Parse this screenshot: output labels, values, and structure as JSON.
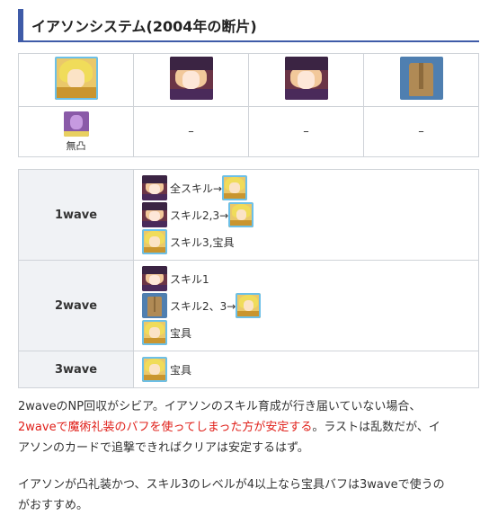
{
  "heading": "イアソンシステム(2004年の断片)",
  "party": {
    "members": [
      {
        "portrait": "jason-portrait-icon"
      },
      {
        "portrait": "witch-caster-portrait-icon"
      },
      {
        "portrait": "witch-caster-portrait-icon"
      },
      {
        "portrait": "mystic-code-coat-icon"
      }
    ],
    "craft_essences": [
      {
        "icon": "craft-essence-icon",
        "label": "無凸"
      },
      {
        "label": "–"
      },
      {
        "label": "–"
      },
      {
        "label": "–"
      }
    ]
  },
  "plan": [
    {
      "wave": "1wave",
      "steps": [
        {
          "actor": "witch-caster-portrait-icon",
          "text": "全スキル→",
          "target": "jason-portrait-icon"
        },
        {
          "actor": "witch-caster-portrait-icon",
          "text": "スキル2,3→",
          "target": "jason-portrait-icon"
        },
        {
          "actor": "jason-portrait-icon",
          "text": "スキル3,宝具"
        }
      ]
    },
    {
      "wave": "2wave",
      "steps": [
        {
          "actor": "witch-caster-portrait-icon",
          "text": "スキル1"
        },
        {
          "actor": "mystic-code-coat-icon",
          "text": "スキル2、3→",
          "target": "jason-portrait-icon"
        },
        {
          "actor": "jason-portrait-icon",
          "text": "宝具"
        }
      ]
    },
    {
      "wave": "3wave",
      "steps": [
        {
          "actor": "jason-portrait-icon",
          "text": "宝具"
        }
      ]
    }
  ],
  "paragraph1": {
    "line1": "2waveのNP回収がシビア。イアソンのスキル育成が行き届いていない場合、",
    "red": "2waveで魔術礼装のバフを使ってしまった方が安定する",
    "after_red": "。ラストは乱数だが、イ",
    "line3": "アソンのカードで追撃できればクリアは安定するはず。"
  },
  "paragraph2": {
    "line1": "イアソンが凸礼装かつ、スキル3のレベルが4以上なら宝具バフは3waveで使うの",
    "line2": "がおすすめ。"
  },
  "colors": {
    "accent": "#3f5ba8",
    "emphasis": "#e0201a",
    "table_border": "#cfd3d8",
    "wave_cell_bg": "#f0f2f5"
  }
}
